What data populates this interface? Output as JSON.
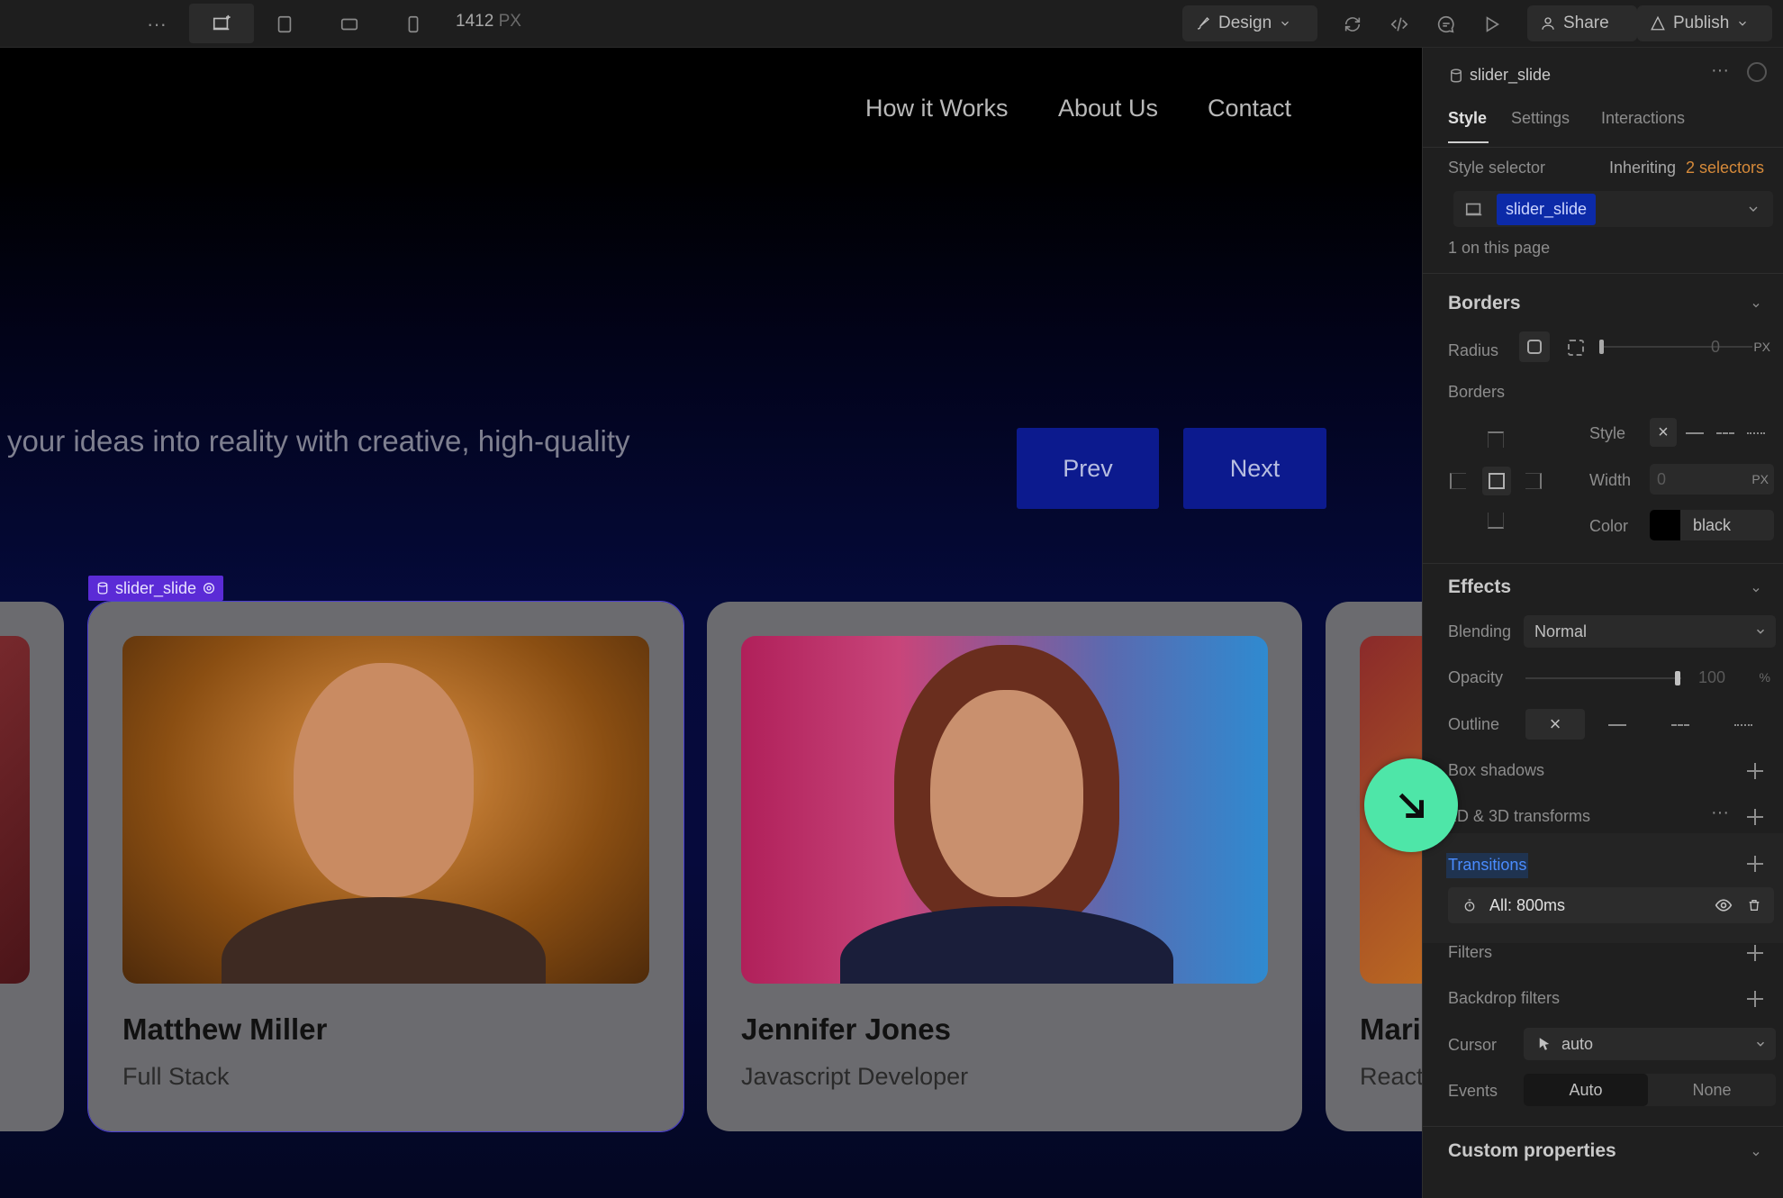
{
  "toolbar": {
    "more_label": "···",
    "breakpoint_value": "1412",
    "breakpoint_unit": "PX",
    "design_label": "Design",
    "share_label": "Share",
    "publish_label": "Publish"
  },
  "site": {
    "nav": [
      "How it Works",
      "About Us",
      "Contact"
    ],
    "hero_text": "your ideas into reality with creative, high-quality",
    "prev_label": "Prev",
    "next_label": "Next",
    "selected_tag": "slider_slide",
    "cards": [
      {
        "name": "Matthew Miller",
        "role": "Full Stack"
      },
      {
        "name": "Jennifer Jones",
        "role": "Javascript Developer"
      },
      {
        "name": "Mari",
        "role": "React"
      }
    ]
  },
  "panel": {
    "element_name": "slider_slide",
    "tabs": [
      "Style",
      "Settings",
      "Interactions"
    ],
    "style_selector_label": "Style selector",
    "inheriting_label": "Inheriting",
    "inheriting_count": "2 selectors",
    "selector_chip": "slider_slide",
    "on_page": "1 on this page",
    "borders_heading": "Borders",
    "radius_label": "Radius",
    "radius_value": "0",
    "px_unit": "PX",
    "borders_label": "Borders",
    "style_label": "Style",
    "width_label": "Width",
    "width_value": "0",
    "color_label": "Color",
    "color_value": "black",
    "effects_heading": "Effects",
    "blending_label": "Blending",
    "blending_value": "Normal",
    "opacity_label": "Opacity",
    "opacity_value": "100",
    "percent_unit": "%",
    "outline_label": "Outline",
    "box_shadows_label": "Box shadows",
    "transforms_label": "2D & 3D transforms",
    "transitions_label": "Transitions",
    "transition_item": "All: 800ms",
    "filters_label": "Filters",
    "backdrop_label": "Backdrop filters",
    "cursor_label": "Cursor",
    "cursor_value": "auto",
    "events_label": "Events",
    "events_auto": "Auto",
    "events_none": "None",
    "custom_props_heading": "Custom properties"
  },
  "colors": {
    "accent": "#0c1a8e",
    "selection": "#5b2bd6",
    "cursor_badge": "#4ee6a8",
    "inheriting_highlight": "#d68a3a",
    "transitions_highlight": "#4a8cff"
  }
}
